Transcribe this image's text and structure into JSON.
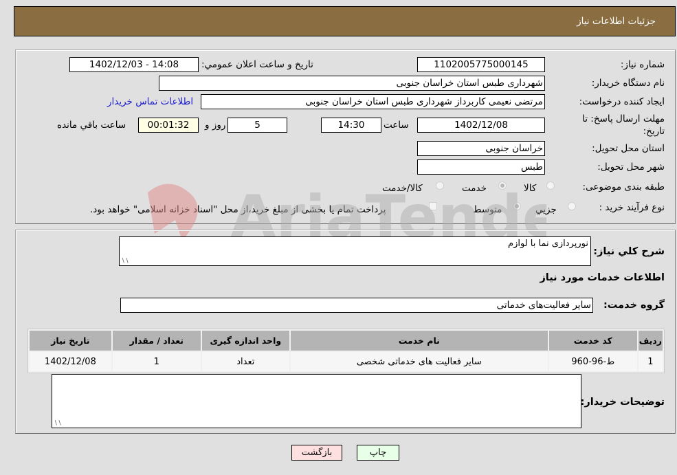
{
  "header": {
    "title": "جزئيات اطلاعات نياز"
  },
  "form": {
    "need_number": {
      "label": "شماره نیاز:",
      "value": "1102005775000145"
    },
    "announce_datetime": {
      "label": "تاريخ و ساعت اعلان عمومي:",
      "value": "1402/12/03 - 14:08"
    },
    "buyer_org": {
      "label": "نام دستگاه خریدار:",
      "value": "شهرداری طبس استان خراسان جنوبی"
    },
    "requester": {
      "label": "ایجاد کننده درخواست:",
      "value": "مرتضی نعیمی کاربرداز شهرداری طبس استان خراسان جنوبی"
    },
    "buyer_contact_link": "اطلاعات تماس خریدار",
    "deadline": {
      "label": "مهلت ارسال پاسخ: تا تاریخ:",
      "date": "1402/12/08",
      "time_label": "ساعت",
      "time": "14:30",
      "days": "5",
      "days_label": "روز و",
      "remaining": "00:01:32",
      "remaining_label": "ساعت باقي مانده"
    },
    "delivery_province": {
      "label": "استان محل تحویل:",
      "value": "خراسان جنوبی"
    },
    "delivery_city": {
      "label": "شهر محل تحویل:",
      "value": "طبس"
    },
    "category": {
      "label": "طبقه بندی موضوعی:",
      "options": [
        "کالا",
        "خدمت",
        "کالا/خدمت"
      ],
      "selected": "خدمت"
    },
    "purchase_type": {
      "label": "نوع فرآیند خرید :",
      "options": [
        "جزيي",
        "متوسط"
      ],
      "selected": "متوسط",
      "treasury_note": "پرداخت تمام یا بخشی از مبلغ خرید،از محل \"اسناد خزانه اسلامی\" خواهد بود."
    }
  },
  "details": {
    "summary_label": "شرح كلي نياز:",
    "summary_value": "نورپردازی نما با لوازم",
    "services_heading": "اطلاعات خدمات مورد نياز",
    "service_group_label": "گروه خدمت:",
    "service_group_value": "سایر فعالیت‌های خدماتی",
    "table": {
      "columns": [
        "رديف",
        "کد خدمت",
        "نام خدمت",
        "واحد اندازه گیری",
        "تعداد / مقدار",
        "تاریخ نیاز"
      ],
      "rows": [
        [
          "1",
          "ط-96-960",
          "سایر فعالیت های خدماتی شخصی",
          "تعداد",
          "1",
          "1402/12/08"
        ]
      ]
    },
    "buyer_notes_label": "توضيحات خريدار:",
    "buyer_notes_value": ""
  },
  "buttons": {
    "print": "چاپ",
    "back": "بازگشت"
  },
  "colors": {
    "header_bg": "#8b6d42",
    "print_bg": "#e8ffe8",
    "back_bg": "#ffe0e0",
    "link": "#2020cc"
  },
  "watermark": "AriaTender.neT"
}
